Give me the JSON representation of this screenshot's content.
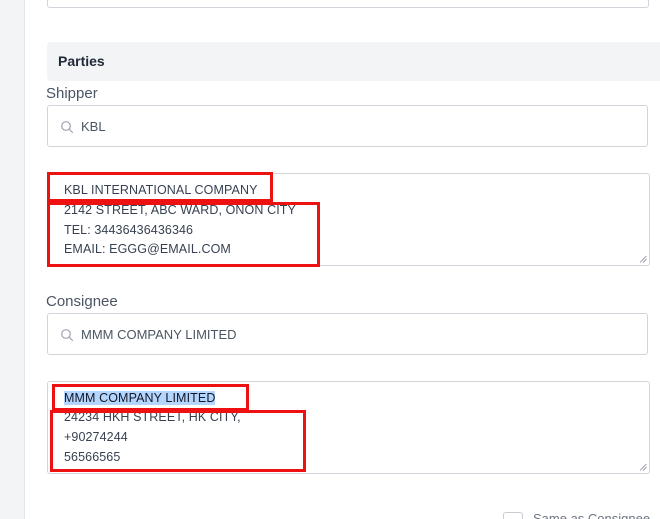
{
  "section": {
    "title": "Parties"
  },
  "shipper": {
    "label": "Shipper",
    "search_value": "KBL",
    "address_lines": [
      "KBL INTERNATIONAL COMPANY",
      "2142 STREET, ABC WARD, ONON CITY",
      "TEL: 34436436436346",
      "EMAIL: EGGG@EMAIL.COM"
    ]
  },
  "consignee": {
    "label": "Consignee",
    "search_value": "MMM COMPANY LIMITED",
    "address_lines": [
      "MMM COMPANY LIMITED",
      "24234 HKH STREET, HK CITY,",
      "+90274244",
      "56566565"
    ],
    "selected_line": "MMM COMPANY LIMITED"
  },
  "bottom_checkbox": {
    "label": "Same as Consignee",
    "checked": false
  },
  "colors": {
    "highlight": "#ee1111",
    "selection": "#b4d5fe",
    "section_bg": "#f3f4f6",
    "border": "#d1d5db"
  },
  "icons": {
    "search": "search-icon",
    "resize": "resize-grip-icon"
  }
}
